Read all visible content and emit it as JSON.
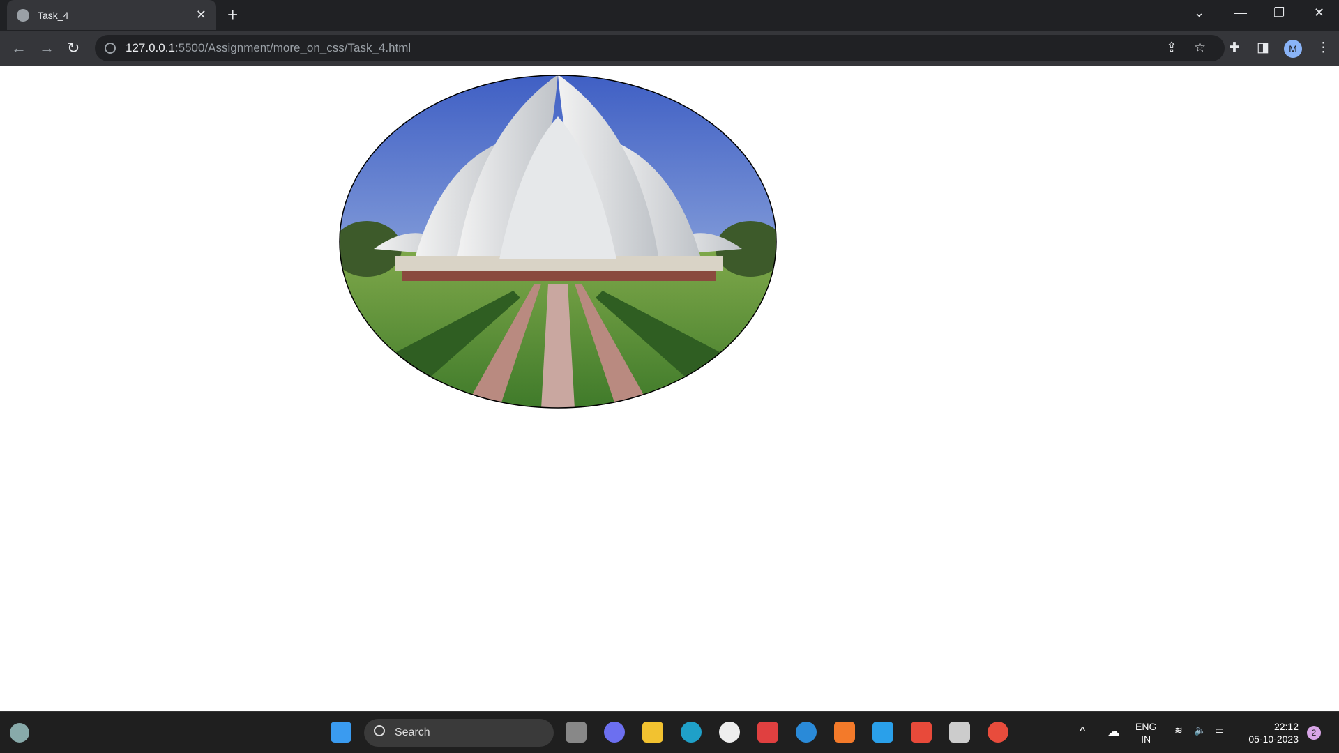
{
  "browser": {
    "tab_title": "Task_4",
    "url_host": "127.0.0.1",
    "url_path": ":5500/Assignment/more_on_css/Task_4.html",
    "profile_initial": "M"
  },
  "page": {
    "image_subject": "lotus-temple"
  },
  "taskbar": {
    "search_label": "Search",
    "lang_line1": "ENG",
    "lang_line2": "IN",
    "time": "22:12",
    "date": "05-10-2023",
    "notification_count": "2"
  }
}
